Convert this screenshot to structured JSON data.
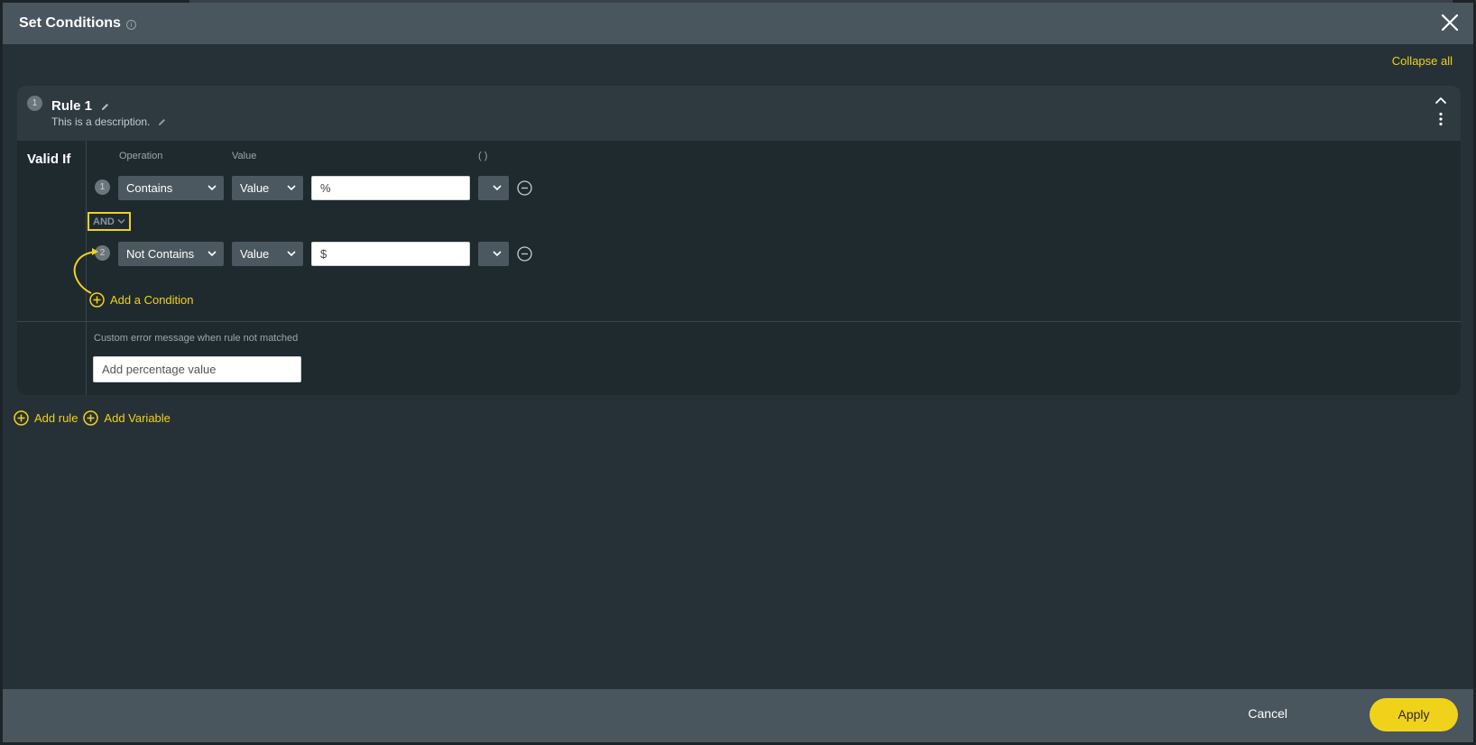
{
  "dialog": {
    "title": "Set Conditions",
    "collapse_all_label": "Collapse all"
  },
  "rule": {
    "number": "1",
    "title": "Rule 1",
    "description": "This is a description.",
    "valid_if_label": "Valid If",
    "columns": {
      "operation": "Operation",
      "value": "Value",
      "parens": "( )"
    },
    "conditions": [
      {
        "number": "1",
        "operation": "Contains",
        "value_type": "Value",
        "value": "%"
      },
      {
        "number": "2",
        "operation": "Not Contains",
        "value_type": "Value",
        "value": "$"
      }
    ],
    "connector": "AND",
    "add_condition_label": "Add a Condition",
    "error_message_label": "Custom error message when rule not matched",
    "error_message_value": "Add percentage value"
  },
  "actions": {
    "add_rule_label": "Add rule",
    "add_variable_label": "Add Variable"
  },
  "footer": {
    "cancel_label": "Cancel",
    "apply_label": "Apply"
  },
  "colors": {
    "accent": "#f1d21b",
    "header_bg": "#49565e",
    "body_bg": "#263137"
  }
}
